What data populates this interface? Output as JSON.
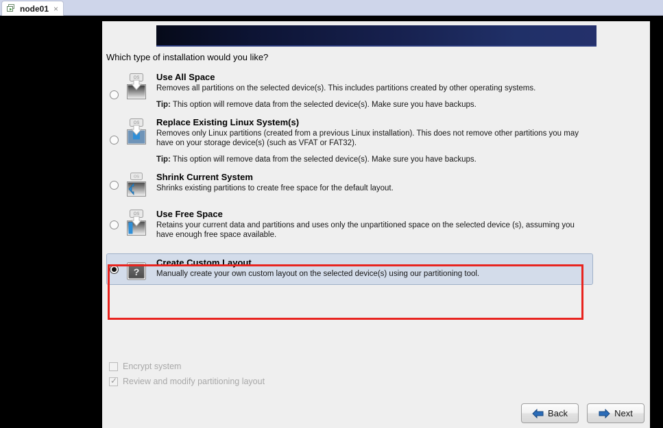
{
  "tab": {
    "label": "node01",
    "icon": "virtual-machine-icon",
    "close": "×"
  },
  "installer": {
    "banner": {
      "gradient_from": "#060a19",
      "gradient_to": "#24306b"
    },
    "question": "Which type of installation would you like?",
    "options": [
      {
        "id": "use-all-space",
        "icon": "disk-overwrite-icon",
        "title": "Use All Space",
        "description": "Removes all partitions on the selected device(s).  This includes partitions created by other operating systems.",
        "tip_label": "Tip:",
        "tip": "This option will remove data from the selected device(s).  Make sure you have backups.",
        "selected": false
      },
      {
        "id": "replace-existing-linux",
        "icon": "disk-replace-linux-icon",
        "title": "Replace Existing Linux System(s)",
        "description": "Removes only Linux partitions (created from a previous Linux installation).  This does not remove other partitions you may have on your storage device(s) (such as VFAT or FAT32).",
        "tip_label": "Tip:",
        "tip": "This option will remove data from the selected device(s).  Make sure you have backups.",
        "selected": false
      },
      {
        "id": "shrink-current-system",
        "icon": "disk-shrink-icon",
        "title": "Shrink Current System",
        "description": "Shrinks existing partitions to create free space for the default layout.",
        "tip_label": "",
        "tip": "",
        "selected": false
      },
      {
        "id": "use-free-space",
        "icon": "disk-free-space-icon",
        "title": "Use Free Space",
        "description": "Retains your current data and partitions and uses only the unpartitioned space on the selected device (s), assuming you have enough free space available.",
        "tip_label": "",
        "tip": "",
        "selected": false
      },
      {
        "id": "create-custom-layout",
        "icon": "question-mark-icon",
        "title": "Create Custom Layout",
        "description": "Manually create your own custom layout on the selected device(s) using our partitioning tool.",
        "tip_label": "",
        "tip": "",
        "selected": true
      }
    ],
    "checkboxes": [
      {
        "id": "encrypt-system",
        "label": "Encrypt system",
        "checked": false
      },
      {
        "id": "review-modify-partitioning",
        "label": "Review and modify partitioning layout",
        "checked": true
      }
    ],
    "buttons": {
      "back": {
        "label": "Back",
        "icon": "arrow-left-icon"
      },
      "next": {
        "label": "Next",
        "icon": "arrow-right-icon"
      }
    },
    "annotation": {
      "target": "create-custom-layout",
      "color": "#e8241f"
    }
  }
}
